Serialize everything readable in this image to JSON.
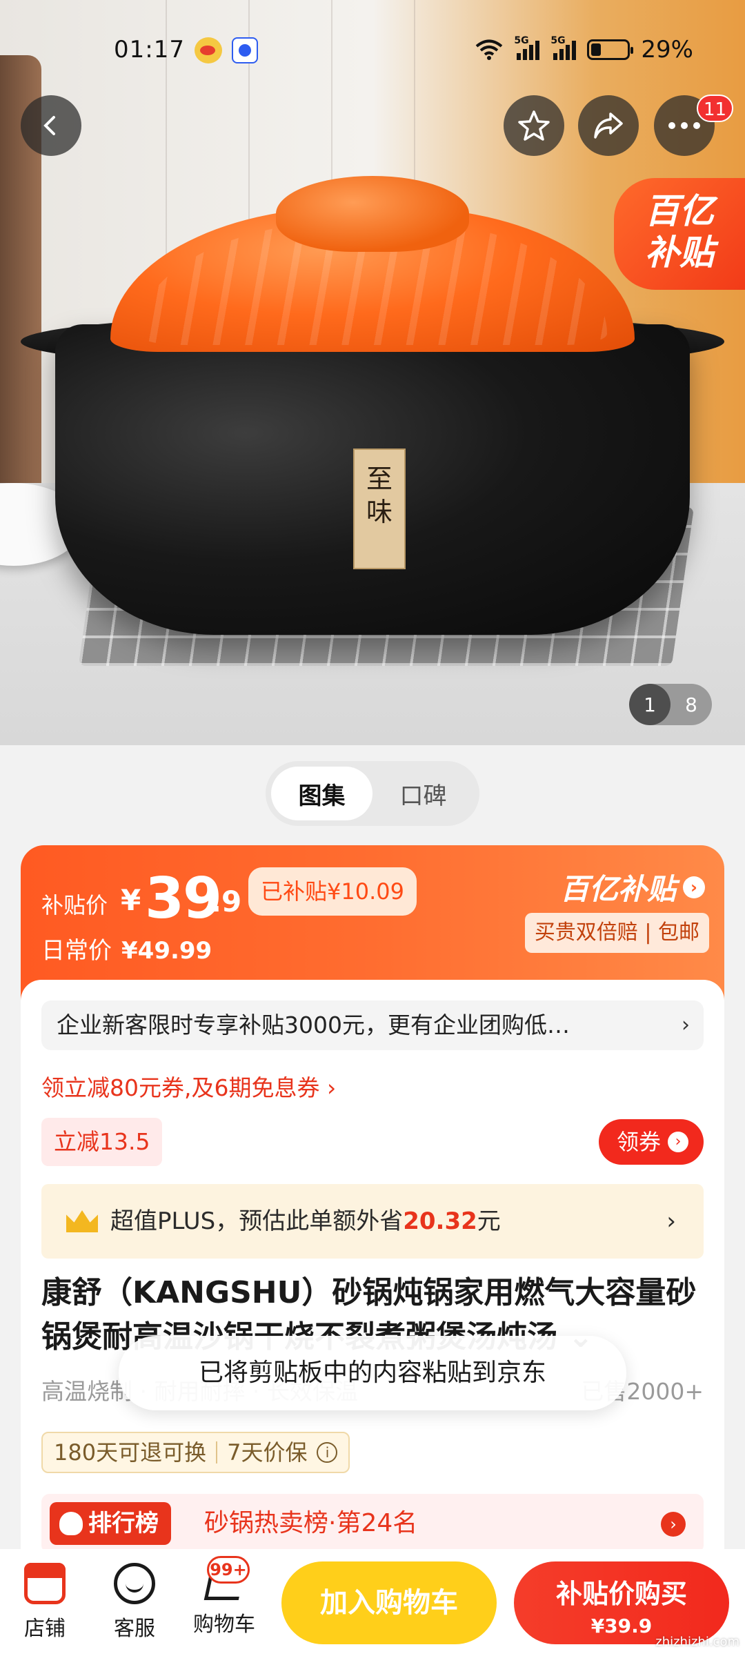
{
  "status_bar": {
    "time": "01:17",
    "battery": "29%",
    "network1": "5G",
    "network2": "5G",
    "battery_level": 0.29
  },
  "nav": {
    "notification_count": "11"
  },
  "hero": {
    "promo_tag_line1": "百亿",
    "promo_tag_line2": "补贴",
    "pot_label_char1": "至",
    "pot_label_char2": "味",
    "pager_current": "1",
    "pager_total": "8"
  },
  "media_tabs": [
    {
      "label": "图集",
      "active": true
    },
    {
      "label": "口碑",
      "active": false
    }
  ],
  "price": {
    "label": "补贴价",
    "currency": "¥",
    "integer": "39",
    "decimal": ".9",
    "subsidized": "已补贴¥10.09",
    "daily_label": "日常价",
    "daily_price": "¥49.99",
    "brand": "百亿补贴",
    "brand_arrow": "›",
    "perks": "买贵双倍赔 | 包邮"
  },
  "promo": {
    "enterprise": "企业新客限时专享补贴3000元，更有企业团购低…",
    "enterprise_chevron": "›",
    "coupon_line": "领立减80元券,及6期免息券 ›",
    "instant_discount": "立减13.5",
    "claim_label": "领券",
    "claim_arrow": "›",
    "plus_prefix": "超值PLUS，预估此单额外省",
    "plus_amount": "20.32",
    "plus_suffix": "元",
    "plus_chevron": "›"
  },
  "product": {
    "title": "康舒（KANGSHU）砂锅炖锅家用燃气大容量砂锅煲耐高温沙锅干烧不裂煮粥煲汤炖汤 ⌄",
    "tags": "高温烧制 · 耐用耐摔 · 长效保温",
    "sold": "已售2000+",
    "service1": "180天可退可换",
    "service2": "7天价保",
    "service_info": "i"
  },
  "rank": {
    "chip": "排行榜",
    "text": "砂锅热卖榜·第24名",
    "arrow": "›"
  },
  "toast": "已将剪贴板中的内容粘贴到京东",
  "bottom_bar": {
    "store": "店铺",
    "service": "客服",
    "cart": "购物车",
    "cart_badge": "99+",
    "add_to_cart": "加入购物车",
    "buy_line1": "补贴价购买",
    "buy_line2": "¥39.9"
  },
  "watermark": "zhizhizhi.com",
  "colors": {
    "accent": "#f2291d",
    "brand_orange": "#ff5a22",
    "cart_yellow": "#ffcf1a"
  }
}
